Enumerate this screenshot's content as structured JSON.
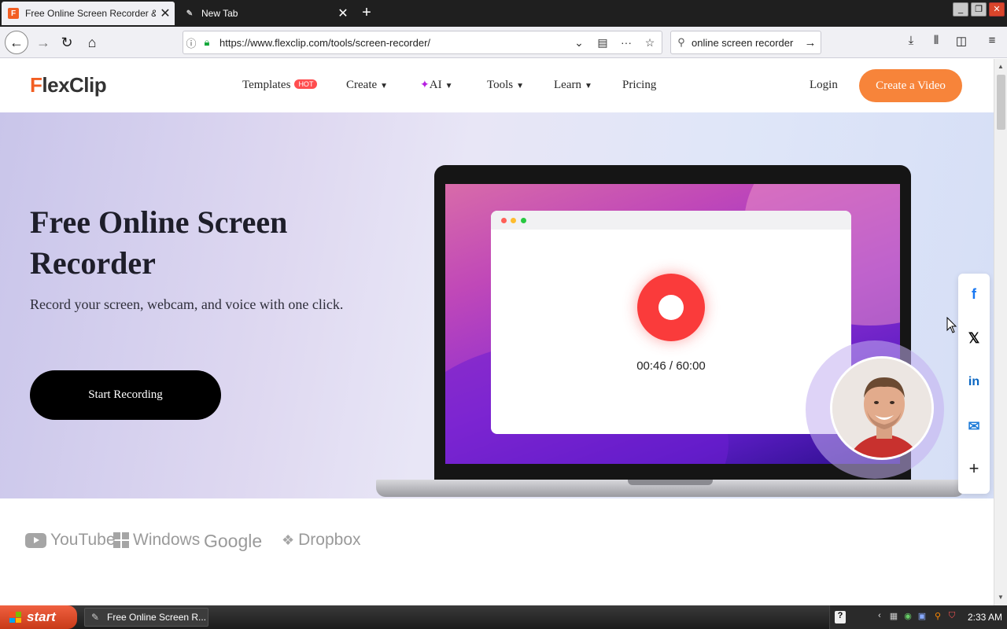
{
  "browser": {
    "tabs": [
      {
        "title": "Free Online Screen Recorder & We",
        "favicon": "F"
      },
      {
        "title": "New Tab",
        "favicon": "new-tab-icon"
      }
    ],
    "url": "https://www.flexclip.com/tools/screen-recorder/",
    "search_value": "online screen recorder"
  },
  "site": {
    "logo": {
      "initial": "F",
      "rest": "lexClip"
    },
    "nav": {
      "templates": "Templates",
      "hot_badge": "HOT",
      "create": "Create",
      "ai": "AI",
      "tools": "Tools",
      "learn": "Learn",
      "pricing": "Pricing"
    },
    "login": "Login",
    "create_video": "Create a Video"
  },
  "hero": {
    "title": "Free Online Screen Recorder",
    "subtitle": "Record your screen, webcam, and voice with one click.",
    "cta": "Start Recording",
    "timer": "00:46 / 60:00"
  },
  "share": {
    "facebook": "f",
    "x": "𝕏",
    "linkedin": "in",
    "more": "+"
  },
  "brands": {
    "youtube": "YouTube",
    "windows": "Windows",
    "google": "Google",
    "dropbox": "Dropbox"
  },
  "taskbar": {
    "start": "start",
    "task_title": "Free Online Screen R...",
    "clock": "2:33 AM"
  },
  "colors": {
    "brand_orange": "#f7843a",
    "record_red": "#fa3b3b",
    "cta_black": "#000000"
  }
}
